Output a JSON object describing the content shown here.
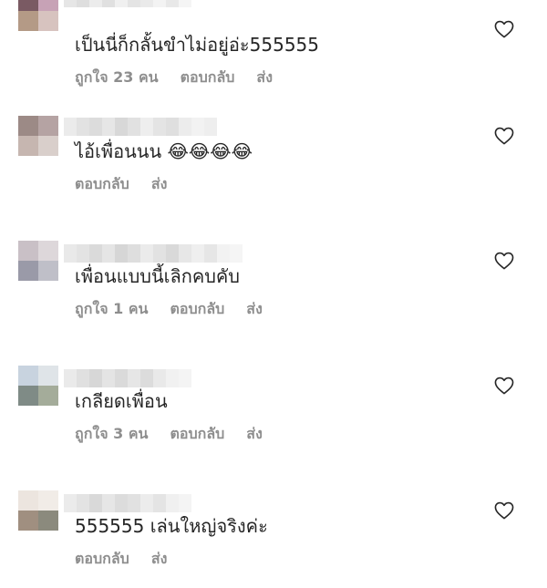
{
  "comments": [
    {
      "text": "เป็นนี่ก็กลั้นขำไม่อยู่อ่ะ555555",
      "likes": "ถูกใจ 23 คน",
      "reply": "ตอบกลับ",
      "send": "ส่ง"
    },
    {
      "text": "ไอ้เพื่อนนน 😂😂😂😂",
      "likes": "",
      "reply": "ตอบกลับ",
      "send": "ส่ง"
    },
    {
      "text": "เพื่อนแบบนี้เลิกคบคับ",
      "likes": "ถูกใจ 1 คน",
      "reply": "ตอบกลับ",
      "send": "ส่ง"
    },
    {
      "text": "เกลียดเพื่อน",
      "likes": "ถูกใจ 3 คน",
      "reply": "ตอบกลับ",
      "send": "ส่ง"
    },
    {
      "text": "555555 เล่นใหญ่จริงค่ะ",
      "likes": "",
      "reply": "ตอบกลับ",
      "send": "ส่ง"
    }
  ],
  "icons": {
    "like": "heart-outline-icon"
  },
  "colors": {
    "text": "#262626",
    "meta": "#8e8e8e",
    "background": "#ffffff"
  }
}
